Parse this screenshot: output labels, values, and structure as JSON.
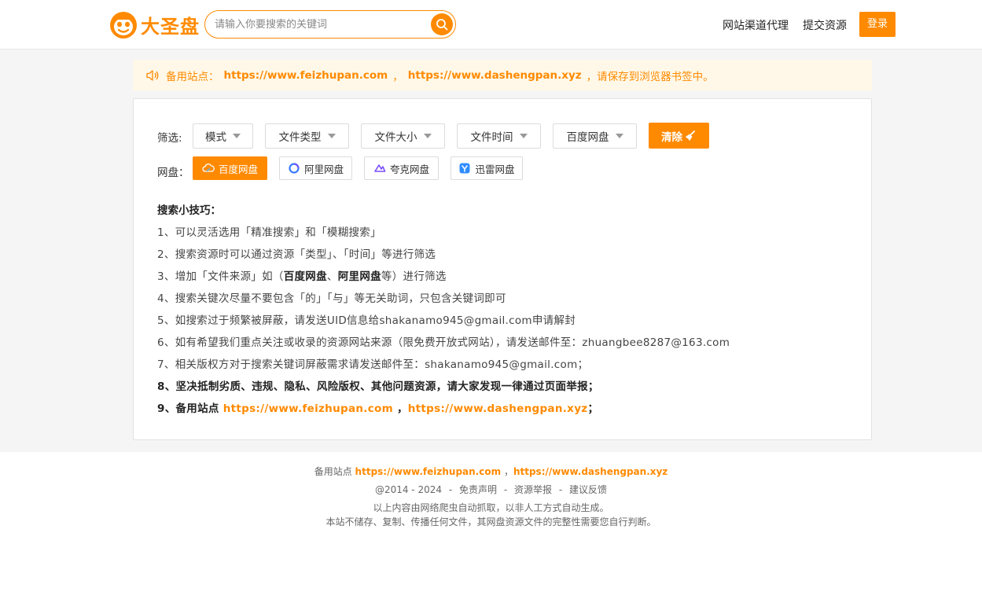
{
  "header": {
    "logo_text": "大圣盘",
    "search_placeholder": "请输入你要搜索的关键词",
    "nav": [
      "网站渠道代理",
      "提交资源"
    ],
    "login_label": "登录"
  },
  "notice": {
    "prefix": "备用站点：",
    "link1": "https://www.feizhupan.com",
    "sep": "，",
    "link2": "https://www.dashengpan.xyz",
    "suffix": "，请保存到浏览器书签中。"
  },
  "filters": {
    "label": "筛选:",
    "dropdowns": [
      "模式",
      "文件类型",
      "文件大小",
      "文件时间",
      "百度网盘"
    ],
    "clear_label": "清除"
  },
  "pans": {
    "label": "网盘：",
    "items": [
      {
        "label": "百度网盘",
        "active": true,
        "icon": "baidu-cloud-icon"
      },
      {
        "label": "阿里网盘",
        "active": false,
        "icon": "aliyun-drive-icon"
      },
      {
        "label": "夸克网盘",
        "active": false,
        "icon": "quark-drive-icon"
      },
      {
        "label": "迅雷网盘",
        "active": false,
        "icon": "xunlei-drive-icon"
      }
    ]
  },
  "tips": {
    "title": "搜索小技巧：",
    "t1": "1、可以灵活选用「精准搜索」和「模糊搜索」",
    "t2": "2、搜索资源时可以通过资源「类型」、「时间」等进行筛选",
    "t3_a": "3、增加「文件来源」如（",
    "t3_b": "百度网盘",
    "t3_c": "、",
    "t3_d": "阿里网盘",
    "t3_e": "等）进行筛选",
    "t4": "4、搜索关键次尽量不要包含「的」「与」等无关助词，只包含关键词即可",
    "t5": "5、如搜索过于频繁被屏蔽，请发送UID信息给shakanamo945@gmail.com申请解封",
    "t6": "6、如有希望我们重点关注或收录的资源网站来源（限免费开放式网站），请发送邮件至：zhuangbee8287@163.com",
    "t7": "7、相关版权方对于搜索关键词屏蔽需求请发送邮件至：shakanamo945@gmail.com；",
    "t8": "8、坚决抵制劣质、违规、隐私、风险版权、其他问题资源，请大家发现一律通过页面举报；",
    "t9_a": "9、备用站点",
    "t9_link1": "https://www.feizhupan.com",
    "t9_sep": "，",
    "t9_link2": "https://www.dashengpan.xyz",
    "t9_end": "；"
  },
  "footer": {
    "backup_label": "备用站点",
    "link1": "https://www.feizhupan.com",
    "sep": "，",
    "link2": "https://www.dashengpan.xyz",
    "copyright": "@2014 - 2024",
    "dash": "-",
    "links": [
      "免责声明",
      "资源举报",
      "建议反馈"
    ],
    "line3": "以上内容由网络爬虫自动抓取，以非人工方式自动生成。",
    "line4": "本站不储存、复制、传播任何文件，其网盘资源文件的完整性需要您自行判断。"
  },
  "colors": {
    "accent": "#ff8a00",
    "notice_bg": "#fff8e8",
    "page_bg": "#f5f5f5"
  }
}
